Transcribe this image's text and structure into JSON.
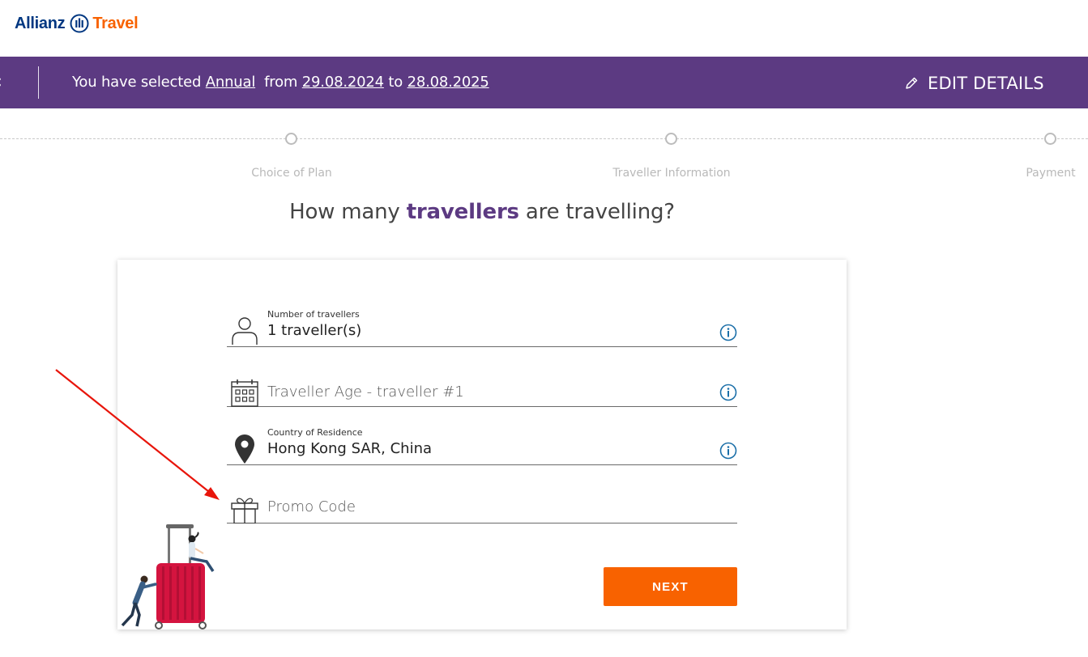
{
  "header": {
    "logo_brand": "Allianz",
    "logo_product": "Travel"
  },
  "summary_bar": {
    "back_icon": "chevron-left-icon",
    "prefix": "You have selected",
    "plan": "Annual",
    "from_word": "from",
    "start_date": "29.08.2024",
    "to_word": "to",
    "end_date": "28.08.2025",
    "edit_label": "EDIT DETAILS",
    "edit_icon": "pencil-icon"
  },
  "progress": {
    "steps": [
      {
        "label": "Choice of Plan"
      },
      {
        "label": "Traveller Information"
      },
      {
        "label": "Payment"
      }
    ]
  },
  "question": {
    "before": "How many",
    "highlight": "travellers",
    "after": "are travelling?"
  },
  "form": {
    "travellers": {
      "label": "Number of travellers",
      "value": "1 traveller(s)",
      "icon": "person-icon",
      "info_icon": "info-icon"
    },
    "age": {
      "placeholder": "Traveller Age - traveller #1",
      "icon": "calendar-icon",
      "info_icon": "info-icon"
    },
    "residence": {
      "label": "Country of Residence",
      "value": "Hong Kong SAR, China",
      "icon": "location-pin-icon",
      "info_icon": "info-icon"
    },
    "promo": {
      "placeholder": "Promo Code",
      "icon": "gift-icon"
    },
    "next_label": "NEXT"
  },
  "colors": {
    "brand_purple": "#5c3a82",
    "accent_orange": "#f86200",
    "allianz_blue": "#003781",
    "info_blue": "#1b6fa8",
    "annotation_red": "#e8150b"
  }
}
